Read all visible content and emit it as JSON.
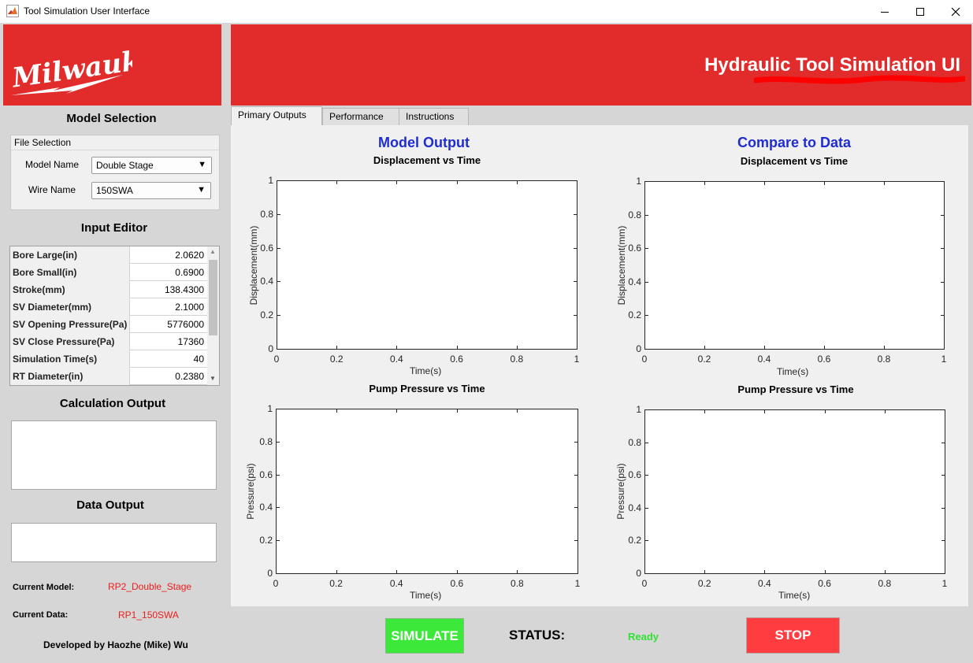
{
  "window": {
    "title": "Tool Simulation User Interface",
    "app_icon": "matlab-icon",
    "controls": [
      "minimize-icon",
      "maximize-icon",
      "close-icon"
    ]
  },
  "brand": {
    "logo_text": "Milwaukee",
    "color": "#e22b2b"
  },
  "header": {
    "title": "Hydraulic Tool Simulation UI"
  },
  "model_selection": {
    "title": "Model Selection",
    "group_title": "File Selection",
    "model_name_label": "Model Name",
    "model_name_value": "Double Stage",
    "wire_name_label": "Wire Name",
    "wire_name_value": "150SWA"
  },
  "input_editor": {
    "title": "Input Editor",
    "rows": [
      {
        "name": "Bore Large(in)",
        "value": "2.0620"
      },
      {
        "name": "Bore Small(in)",
        "value": "0.6900"
      },
      {
        "name": "Stroke(mm)",
        "value": "138.4300"
      },
      {
        "name": "SV Diameter(mm)",
        "value": "2.1000"
      },
      {
        "name": "SV Opening Pressure(Pa)",
        "value": "5776000"
      },
      {
        "name": "SV Close Pressure(Pa)",
        "value": "17360"
      },
      {
        "name": "Simulation Time(s)",
        "value": "40"
      },
      {
        "name": "RT Diameter(in)",
        "value": "0.2380"
      }
    ]
  },
  "calculation_output": {
    "title": "Calculation Output",
    "value": ""
  },
  "data_output": {
    "title": "Data Output",
    "value": ""
  },
  "current": {
    "model_label": "Current Model:",
    "model_value": "RP2_Double_Stage",
    "data_label": "Current Data:",
    "data_value": "RP1_150SWA"
  },
  "credit": "Developed by Haozhe (Mike) Wu",
  "tabs": [
    "Primary Outputs",
    "Performance",
    "Instructions"
  ],
  "columns": {
    "left_title": "Model Output",
    "right_title": "Compare to Data",
    "title_color": "#1f2dd0"
  },
  "plots": {
    "disp_title": "Displacement vs Time",
    "pump_title": "Pump Pressure vs Time",
    "disp_ylabel": "Displacement(mm)",
    "pump_ylabel": "Pressure(psi)",
    "xlabel": "Time(s)",
    "xticks": [
      "0",
      "0.2",
      "0.4",
      "0.6",
      "0.8",
      "1"
    ],
    "yticks": [
      "0",
      "0.2",
      "0.4",
      "0.6",
      "0.8",
      "1"
    ]
  },
  "controls": {
    "simulate_label": "SIMULATE",
    "simulate_color": "#3ce83a",
    "status_label": "STATUS:",
    "status_value": "Ready",
    "status_color": "#35e035",
    "stop_label": "STOP",
    "stop_color": "#ff3d41"
  }
}
